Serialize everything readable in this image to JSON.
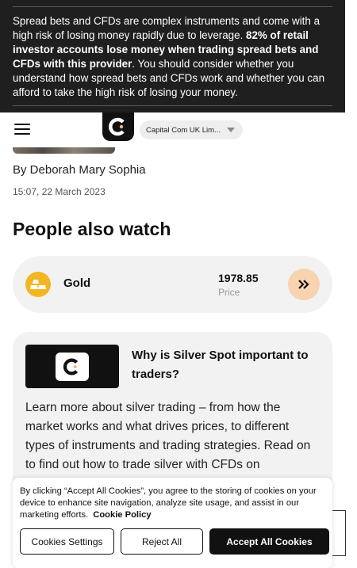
{
  "risk_banner": {
    "text_before": "Spread bets and CFDs are complex instruments and come with a high risk of losing money rapidly due to leverage. ",
    "text_bold": "82% of retail investor accounts lose money when trading spread bets and CFDs with this provider",
    "text_after": ". You should consider whether you understand how spread bets and CFDs work and whether you can afford to take the high risk of losing your money."
  },
  "header": {
    "entity_selector": "Capital Com UK Lim..."
  },
  "article": {
    "author": "By Deborah Mary Sophia",
    "date": "15:07, 22 March 2023"
  },
  "people_also_watch": {
    "title": "People also watch",
    "asset": {
      "name": "Gold",
      "price": "1978.85",
      "price_label": "Price",
      "icon": "gold-bars-icon",
      "icon_color": "#f4b522",
      "button_color": "#f7d3b0"
    }
  },
  "promo": {
    "title": "Why is Silver Spot important to traders?",
    "body": "Learn more about silver trading – from how the market works and what drives prices, to different types of instruments and trading strategies. Read on to find out how to trade silver with CFDs on"
  },
  "cookies": {
    "text": "By clicking “Accept All Cookies”, you agree to the storing of cookies on your device to enhance site navigation, analyze site usage, and assist in our marketing efforts.",
    "policy_link": "Cookie Policy",
    "settings_label": "Cookies Settings",
    "reject_label": "Reject All",
    "accept_label": "Accept All Cookies"
  }
}
